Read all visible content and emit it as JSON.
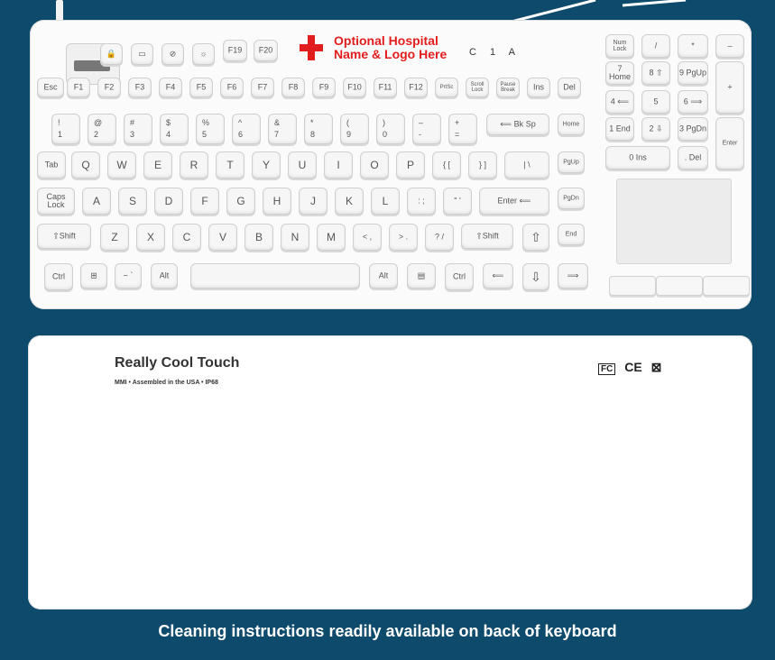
{
  "keyboard": {
    "logo_line1": "Optional Hospital",
    "logo_line2": "Name & Logo Here",
    "leds": "C 1 A",
    "top_icons": [
      "lock-icon",
      "monitor-icon",
      "mute-icon",
      "brightness-icon"
    ],
    "fkeys_top": [
      "F19",
      "F20"
    ],
    "row_func": [
      "Esc",
      "F1",
      "F2",
      "F3",
      "F4",
      "F5",
      "F6",
      "F7",
      "F8",
      "F9",
      "F10",
      "F11",
      "F12",
      "PrtSc",
      "Scroll Lock",
      "Pause Break",
      "Ins",
      "Del"
    ],
    "row_num": [
      {
        "top": "!",
        "bot": "1"
      },
      {
        "top": "@",
        "bot": "2"
      },
      {
        "top": "#",
        "bot": "3"
      },
      {
        "top": "$",
        "bot": "4"
      },
      {
        "top": "%",
        "bot": "5"
      },
      {
        "top": "^",
        "bot": "6"
      },
      {
        "top": "&",
        "bot": "7"
      },
      {
        "top": "*",
        "bot": "8"
      },
      {
        "top": "(",
        "bot": "9"
      },
      {
        "top": ")",
        "bot": "0"
      },
      {
        "top": "–",
        "bot": "-"
      },
      {
        "top": "+",
        "bot": "="
      }
    ],
    "bksp": "⟸ Bk Sp",
    "home": "Home",
    "row_q": [
      "Tab",
      "Q",
      "W",
      "E",
      "R",
      "T",
      "Y",
      "U",
      "I",
      "O",
      "P",
      "{ [",
      "} ]",
      "| \\",
      "PgUp"
    ],
    "row_a": [
      "Caps Lock",
      "A",
      "S",
      "D",
      "F",
      "G",
      "H",
      "J",
      "K",
      "L",
      ": ;",
      "\" '",
      "Enter ⟸",
      "PgDn"
    ],
    "row_z": [
      "⇧Shift",
      "Z",
      "X",
      "C",
      "V",
      "B",
      "N",
      "M",
      "< ,",
      "> .",
      "? /",
      "⇧Shift",
      "⇧",
      "End"
    ],
    "row_bottom": [
      "Ctrl",
      "⊞",
      "~ `",
      "Alt",
      "",
      "Alt",
      "▤",
      "Ctrl",
      "⟸",
      "⇩",
      "⟹"
    ],
    "numpad": [
      [
        "Num Lock",
        "/",
        "*",
        "–"
      ],
      [
        "7 Home",
        "8 ⇧",
        "9 PgUp",
        "+"
      ],
      [
        "4 ⟸",
        "5",
        "6 ⟹"
      ],
      [
        "1 End",
        "2 ⇩",
        "3 PgDn",
        "Enter"
      ],
      [
        "0 Ins",
        ". Del"
      ]
    ]
  },
  "back": {
    "title": "Really Cool Touch",
    "subtitle": "MMI  •  Assembled in the USA  •  IP68",
    "cert": "CE"
  },
  "caption": "Cleaning instructions readily available on back of keyboard"
}
